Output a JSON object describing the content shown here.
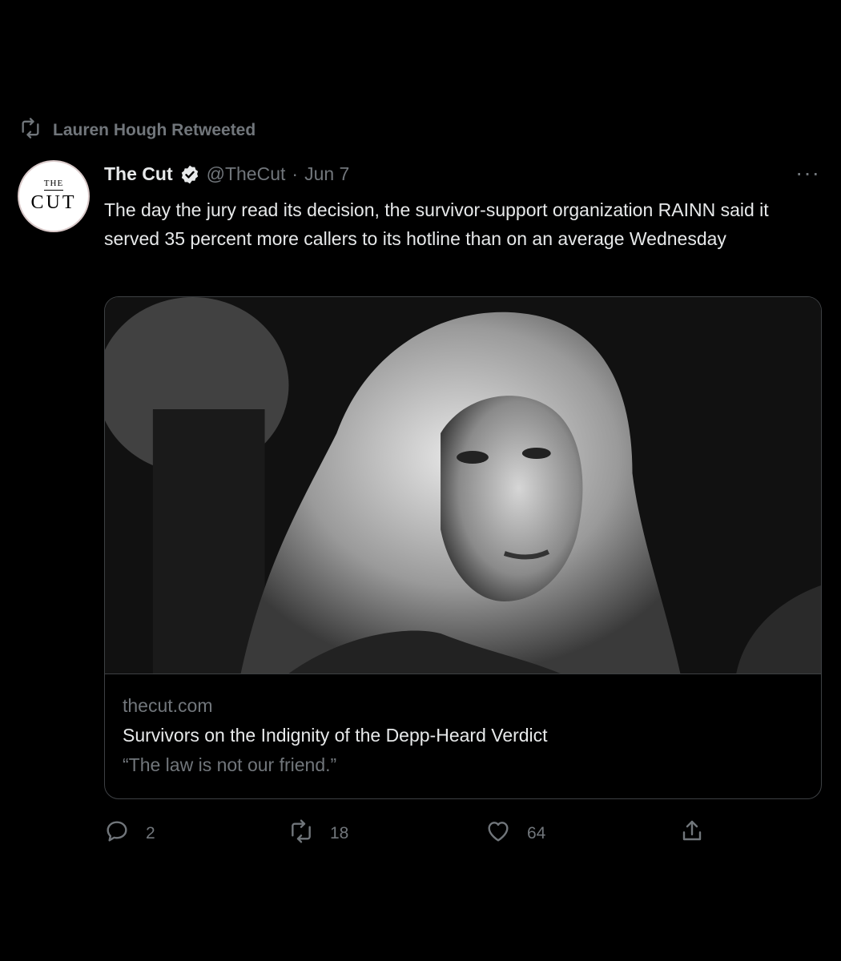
{
  "retweet": {
    "label": "Lauren Hough Retweeted",
    "icon": "retweet-icon"
  },
  "tweet": {
    "author_name": "The Cut",
    "avatar_top": "THE",
    "avatar_bottom": "CUT",
    "handle": "@TheCut",
    "separator": "·",
    "date": "Jun 7",
    "more": "···",
    "text": "The day the jury read its decision, the survivor-support organization RAINN said it served 35 percent more callers to its hotline than on an average Wednesday"
  },
  "card": {
    "domain": "thecut.com",
    "headline": "Survivors on the Indignity of the Depp-Heard Verdict",
    "description": "“The law is not our friend.”"
  },
  "actions": {
    "replies": "2",
    "retweets": "18",
    "likes": "64"
  },
  "colors": {
    "background": "#000000",
    "text": "#e7e9ea",
    "muted": "#71767b",
    "border": "#3e4144"
  }
}
